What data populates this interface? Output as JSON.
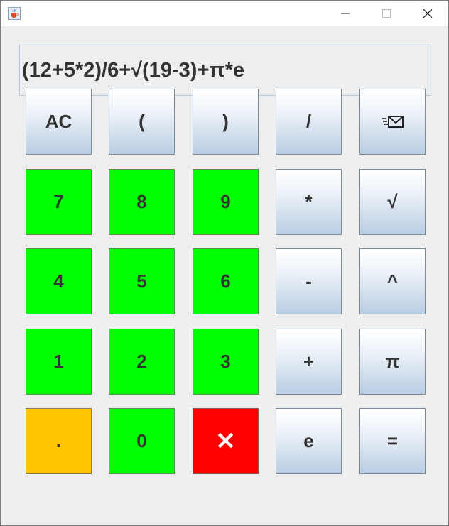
{
  "window": {
    "controls": {
      "minimize_icon": "minimize-icon",
      "maximize_icon": "maximize-icon",
      "close_icon": "close-icon"
    },
    "app_icon": "java-cup-icon"
  },
  "display": {
    "expression": "(12+5*2)/6+√(19-3)+π*e"
  },
  "keypad": {
    "rows": [
      [
        {
          "label": "AC",
          "color": "blue"
        },
        {
          "label": "(",
          "color": "blue"
        },
        {
          "label": ")",
          "color": "blue"
        },
        {
          "label": "/",
          "color": "blue"
        },
        {
          "label": "",
          "icon": "send-mail-icon",
          "color": "blue"
        }
      ],
      [
        {
          "label": "7",
          "color": "green"
        },
        {
          "label": "8",
          "color": "green"
        },
        {
          "label": "9",
          "color": "green"
        },
        {
          "label": "*",
          "color": "blue"
        },
        {
          "label": "√",
          "color": "blue"
        }
      ],
      [
        {
          "label": "4",
          "color": "green"
        },
        {
          "label": "5",
          "color": "green"
        },
        {
          "label": "6",
          "color": "green"
        },
        {
          "label": "-",
          "color": "blue"
        },
        {
          "label": "^",
          "color": "blue"
        }
      ],
      [
        {
          "label": "1",
          "color": "green"
        },
        {
          "label": "2",
          "color": "green"
        },
        {
          "label": "3",
          "color": "green"
        },
        {
          "label": "+",
          "color": "blue"
        },
        {
          "label": "π",
          "color": "blue"
        }
      ],
      [
        {
          "label": ".",
          "color": "orange"
        },
        {
          "label": "0",
          "color": "green"
        },
        {
          "label": "✕",
          "color": "red"
        },
        {
          "label": "e",
          "color": "blue"
        },
        {
          "label": "=",
          "color": "blue"
        }
      ]
    ]
  },
  "colors": {
    "green": "#00ff00",
    "orange": "#ffc400",
    "red": "#ff0000",
    "window_bg": "#eeeeee"
  }
}
